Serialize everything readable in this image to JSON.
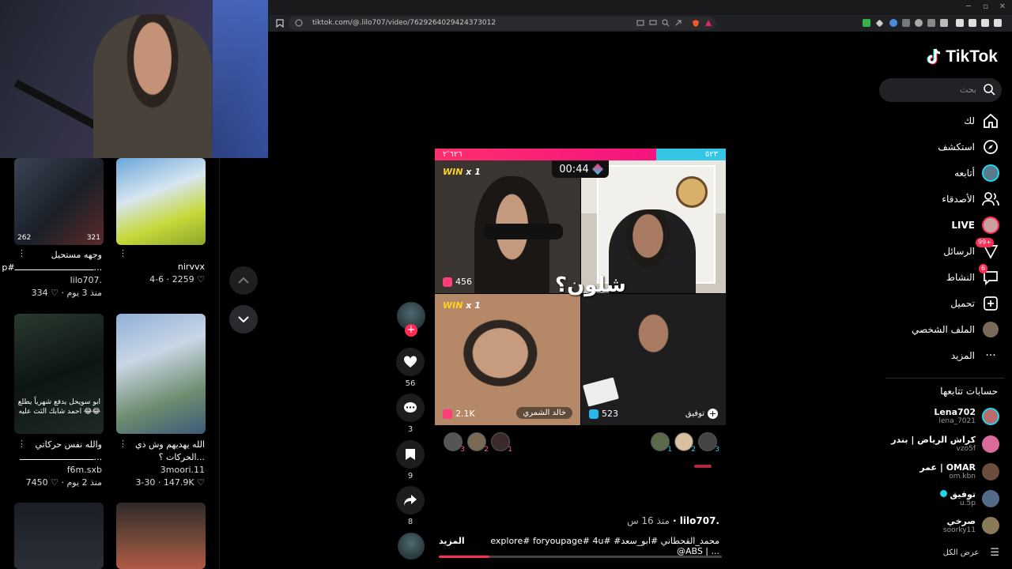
{
  "browser": {
    "url": "tiktok.com/@.lilo707/video/7629264029424373012"
  },
  "left_grid": {
    "items": [
      {
        "views": "262",
        "views2": "321",
        "caption": "",
        "title": "وجهه مستحيل",
        "title2": "p#ـــــــــــــــــــــــــــــــ...",
        "author": "lilo707.",
        "likes": "334",
        "age": "منذ 3 يوم"
      },
      {
        "views": "",
        "views2": "",
        "caption": "",
        "title": "",
        "title2": "",
        "author": "nirvvx",
        "likes": "2259",
        "age": "4-6"
      },
      {
        "views": "",
        "views2": "",
        "caption": "ابو سويحل يدفع شهرياً يطلع احمد شابك الثث عليه 😂😂",
        "title": "والله نفس حركاتي",
        "title2": "ـــــــــــــــــــــــــــــ...",
        "author": "f6m.sxb",
        "likes": "7450",
        "age": "منذ 2 يوم"
      },
      {
        "views": "",
        "views2": "",
        "caption": "",
        "title": "الله يهديهم وش ذي",
        "title2": "الحركات ؟...",
        "author": "3moori.11",
        "likes": "147.9K",
        "age": "3-30"
      }
    ]
  },
  "video": {
    "score_left": "٢٬٦٢٦",
    "score_right": "٥٢٣",
    "timer": "00:44",
    "win_label": "WIN",
    "win_count": "x 1",
    "gifts": [
      "456",
      "2.1K",
      "523"
    ],
    "name_tag": "خالد الشمري",
    "follow_tag": "توفيق",
    "overlay_text": "شلون؟",
    "ranks_left": [
      "3",
      "2",
      "1"
    ],
    "ranks_right": [
      "1",
      "2",
      "3"
    ],
    "progress_pct": 18
  },
  "actions": {
    "likes": "56",
    "comments": "3",
    "saves": "9",
    "shares": "8"
  },
  "caption": {
    "user": "lilo707.",
    "age": "منذ 16 س",
    "text": "explore# foryoupage# 4u# #محمد_القحطاني #ابو_سعد @ABS | ...",
    "more": "المزيد"
  },
  "sidebar": {
    "logo": "TikTok",
    "search_placeholder": "بحث",
    "nav": [
      {
        "label": "لك",
        "icon": "home-icon"
      },
      {
        "label": "استكشف",
        "icon": "compass-icon"
      },
      {
        "label": "أتابعه",
        "icon": "following-avatar-icon"
      },
      {
        "label": "الأصدقاء",
        "icon": "friends-icon"
      },
      {
        "label": "LIVE",
        "icon": "live-icon"
      },
      {
        "label": "الرسائل",
        "icon": "messages-icon",
        "badge": "99+"
      },
      {
        "label": "النشاط",
        "icon": "activity-icon",
        "badge": "6"
      },
      {
        "label": "تحميل",
        "icon": "upload-icon"
      },
      {
        "label": "الملف الشخصي",
        "icon": "profile-icon"
      },
      {
        "label": "المزيد",
        "icon": "more-icon"
      }
    ],
    "following_title": "حسابات تتابعها",
    "accounts": [
      {
        "name": "Lena702",
        "handle": "lena_7021",
        "color": "#b86c6c"
      },
      {
        "name": "كراش الرياض | بندر",
        "handle": "vzo5f",
        "color": "#d96a9a"
      },
      {
        "name": "عمر | OMAR",
        "handle": "om.kbn",
        "color": "#6b4d3d"
      },
      {
        "name": "توفيق",
        "handle": "u.5p",
        "color": "#556a88"
      },
      {
        "name": "صرخي",
        "handle": "soorky11",
        "color": "#8a7a5a"
      }
    ],
    "see_all": "عرض الكل"
  },
  "colors": {
    "accent": "#fe2c55",
    "pk_pink": "#ff2e6e",
    "pk_blue": "#35c6e6",
    "verified": "#20d5ec"
  }
}
